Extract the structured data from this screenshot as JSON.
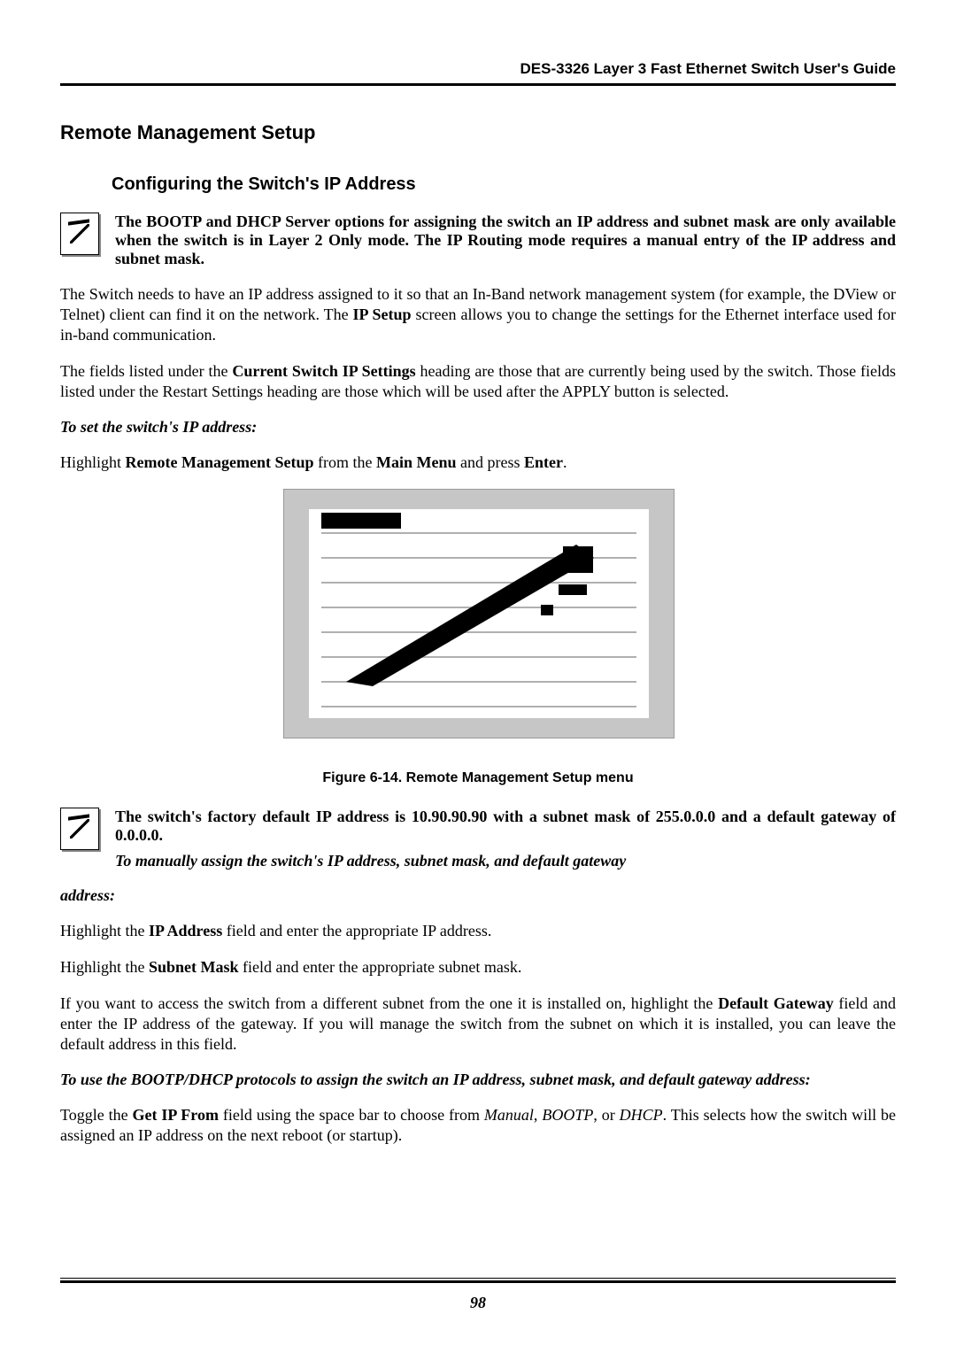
{
  "header": {
    "running": "DES-3326 Layer 3 Fast Ethernet Switch User's Guide"
  },
  "section": {
    "h1": "Remote Management Setup",
    "h2": "Configuring the Switch's IP Address"
  },
  "note1": "The BOOTP and DHCP Server options for assigning the switch an IP address and subnet mask are only available when the switch is in Layer 2 Only mode. The IP Routing mode requires a manual entry of the IP address and subnet mask.",
  "para1": {
    "pre": "The Switch needs to have an IP address assigned to it so that an In-Band network management system (for example, the DView or Telnet) client can find it on the network. The ",
    "bold": "IP Setup",
    "post": " screen allows you to change the settings for the Ethernet interface used for in-band communication."
  },
  "para2": {
    "pre": "The fields listed under the ",
    "bold": "Current Switch IP Settings",
    "post": " heading are those that are currently being used by the switch. Those fields listed under the Restart Settings heading are those which will be used after the APPLY button is selected."
  },
  "sub1": "To set the switch's IP address:",
  "para3": {
    "p1": "Highlight ",
    "b1": "Remote Management Setup",
    "p2": " from the ",
    "b2": "Main Menu",
    "p3": " and press ",
    "b3": "Enter",
    "p4": "."
  },
  "figcaption": "Figure 6-14.  Remote Management Setup menu",
  "note2": "The switch's factory default IP address is 10.90.90.90 with a subnet mask of 255.0.0.0 and a default gateway of 0.0.0.0.",
  "note2_sub": "To manually assign the switch's IP address, subnet mask, and default gateway",
  "note2_sub_tail": "address:",
  "para4": {
    "p1": "Highlight the ",
    "b1": "IP Address",
    "p2": " field and enter the appropriate IP address."
  },
  "para5": {
    "p1": "Highlight the ",
    "b1": "Subnet Mask",
    "p2": " field and enter the appropriate subnet mask."
  },
  "para6": {
    "p1": "If you want to access the switch from a different subnet from the one it is installed on, highlight the ",
    "b1": "Default Gateway",
    "p2": " field and enter the IP address of the gateway. If you will manage the switch from the subnet on which it is installed, you can leave the default address in this field."
  },
  "sub2": "To use the BOOTP/DHCP protocols to assign the switch an IP address, subnet mask, and default gateway address:",
  "para7": {
    "p1": "Toggle the ",
    "b1": "Get IP From",
    "p2": " field using the space bar to choose from ",
    "i1": "Manual",
    "p3": ", ",
    "i2": "BOOTP",
    "p4": ", or ",
    "i3": "DHCP",
    "p5": ". This selects how the switch will be assigned an IP address on the next reboot (or startup)."
  },
  "pagenum": "98"
}
